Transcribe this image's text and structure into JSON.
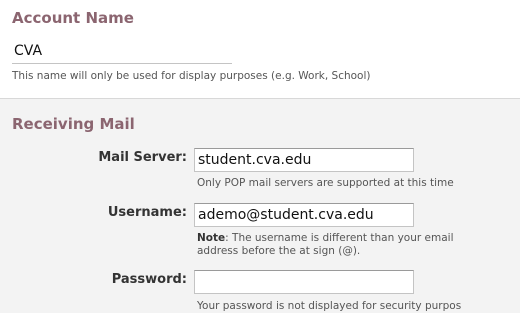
{
  "account": {
    "title": "Account Name",
    "name_value": "CVA",
    "hint": "This name will only be used for display purposes (e.g. Work, School)"
  },
  "receiving": {
    "title": "Receiving Mail",
    "mail_server": {
      "label": "Mail Server:",
      "value": "student.cva.edu",
      "hint": "Only POP mail servers are supported at this time"
    },
    "username": {
      "label": "Username:",
      "value": "ademo@student.cva.edu",
      "hint_bold": "Note",
      "hint_rest": ": The username is different than your email",
      "hint_line2": "address before the at sign (@)."
    },
    "password": {
      "label": "Password:",
      "value": "",
      "hint": "Your password is not displayed for security purpos"
    }
  }
}
